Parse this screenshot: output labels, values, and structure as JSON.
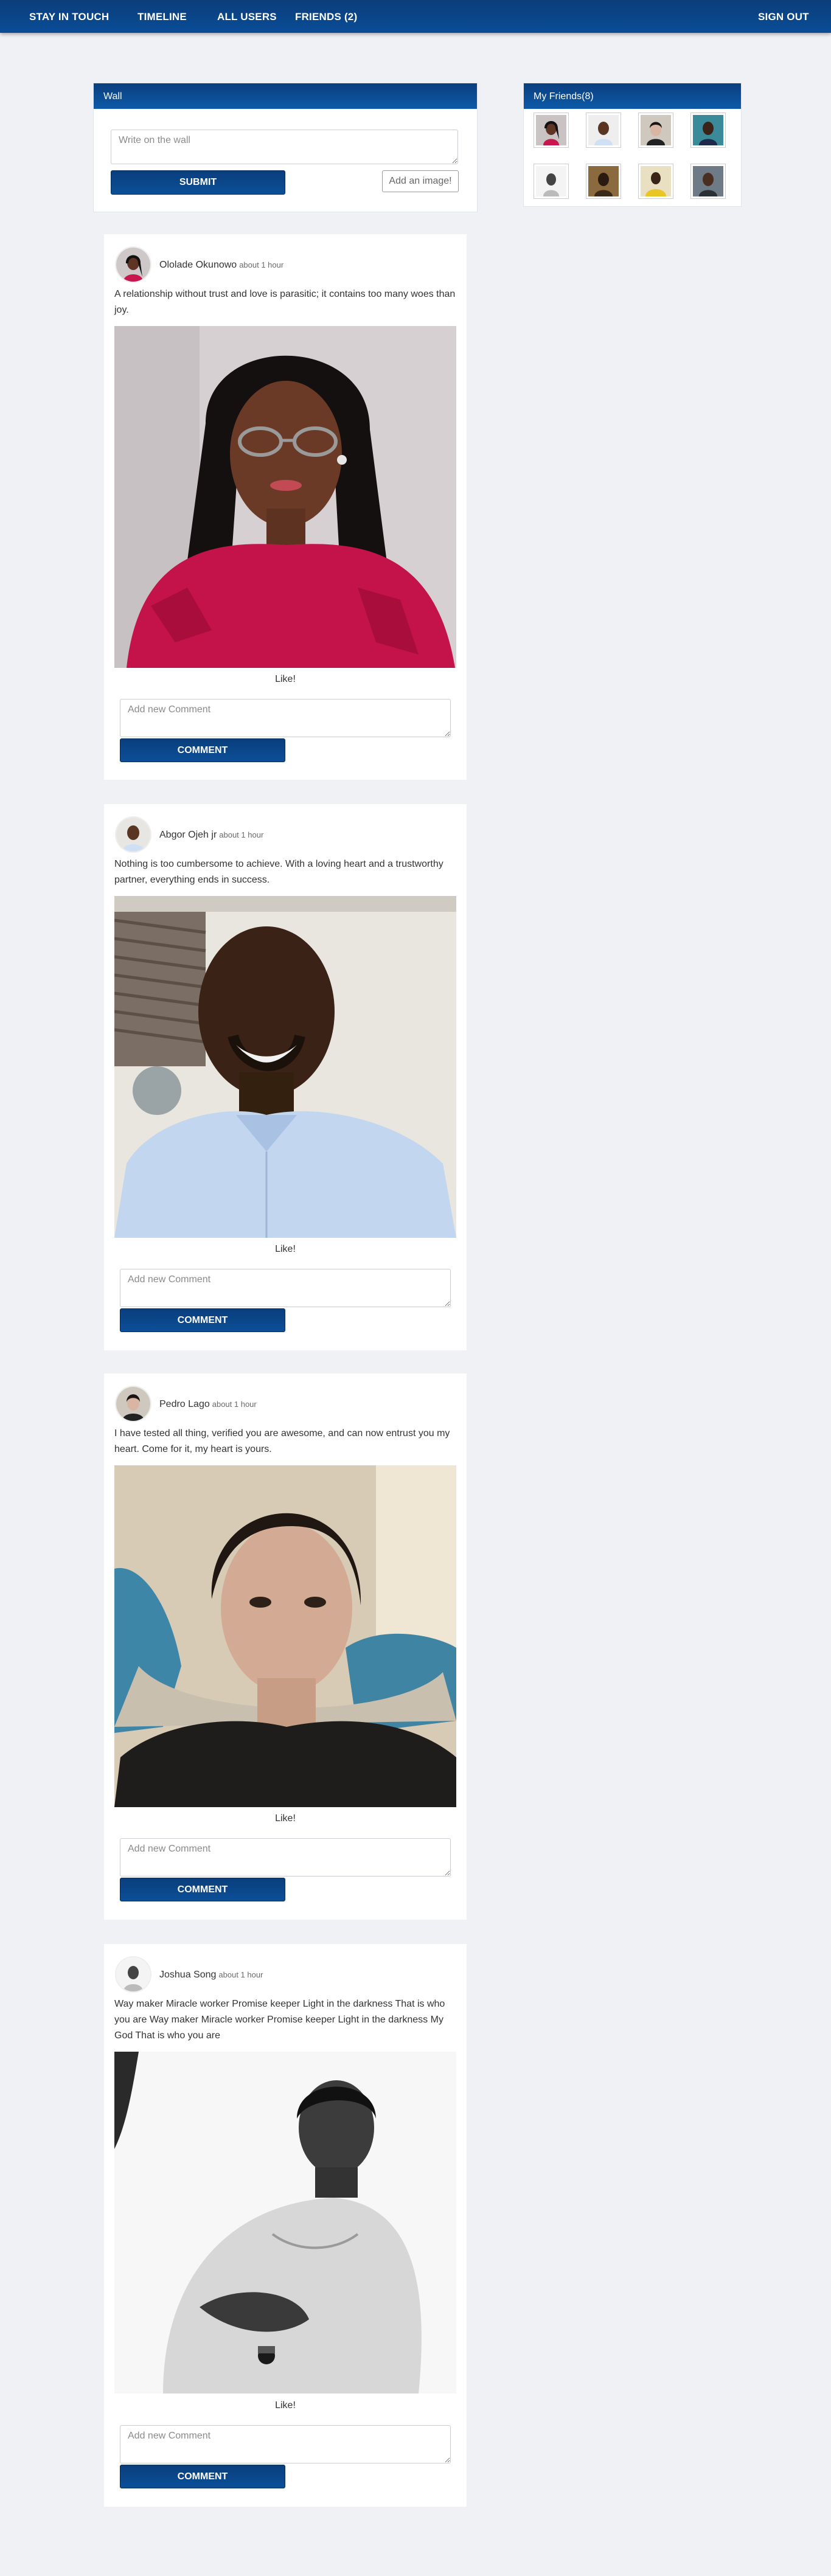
{
  "nav": {
    "brand": "STAY IN TOUCH",
    "timeline": "TIMELINE",
    "all_users": "ALL USERS",
    "friends": "FRIENDS (2)",
    "sign_out": "SIGN OUT"
  },
  "wall": {
    "title": "Wall",
    "placeholder": "Write on the wall",
    "submit_label": "SUBMIT",
    "add_image_label": "Add an image!"
  },
  "friends_panel": {
    "title": "My Friends(8)"
  },
  "posts": [
    {
      "author": "Ololade Okunowo",
      "time": "about 1 hour",
      "text": "A relationship without trust and love is parasitic; it contains too many woes than joy.",
      "like_label": "Like!",
      "comment_placeholder": "Add new Comment",
      "comment_label": "COMMENT"
    },
    {
      "author": "Abgor Ojeh jr",
      "time": "about 1 hour",
      "text": "Nothing is too cumbersome to achieve. With a loving heart and a trustworthy partner, everything ends in success.",
      "like_label": "Like!",
      "comment_placeholder": "Add new Comment",
      "comment_label": "COMMENT"
    },
    {
      "author": "Pedro Lago",
      "time": "about 1 hour",
      "text": "I have tested all thing, verified you are awesome, and can now entrust you my heart. Come for it, my heart is yours.",
      "like_label": "Like!",
      "comment_placeholder": "Add new Comment",
      "comment_label": "COMMENT"
    },
    {
      "author": "Joshua Song",
      "time": "about 1 hour",
      "text": "Way maker Miracle worker Promise keeper Light in the darkness That is who you are Way maker Miracle worker Promise keeper Light in the darkness My God That is who you are",
      "like_label": "Like!",
      "comment_placeholder": "Add new Comment",
      "comment_label": "COMMENT"
    }
  ],
  "colors": {
    "primary": "#0b4a92",
    "page_background": "#eff1f5"
  }
}
